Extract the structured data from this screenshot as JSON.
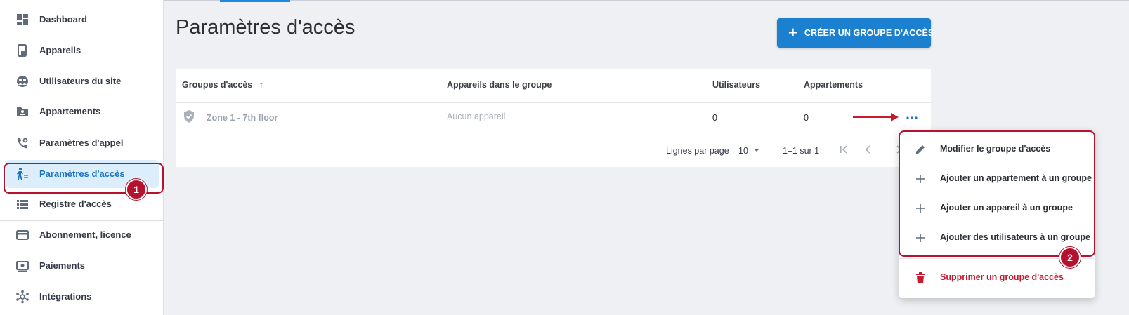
{
  "sidebar": {
    "items": [
      {
        "label": "Dashboard",
        "icon": "dashboard-icon"
      },
      {
        "label": "Appareils",
        "icon": "device-icon"
      },
      {
        "label": "Utilisateurs du site",
        "icon": "users-icon"
      },
      {
        "label": "Appartements",
        "icon": "apartment-icon"
      },
      {
        "label": "Paramètres d'appel",
        "icon": "call-settings-icon"
      },
      {
        "label": "Paramètres d'accès",
        "icon": "access-settings-icon",
        "active": true
      },
      {
        "label": "Registre d'accès",
        "icon": "access-log-icon"
      },
      {
        "label": "Abonnement, licence",
        "icon": "subscription-icon"
      },
      {
        "label": "Paiements",
        "icon": "payments-icon"
      },
      {
        "label": "Intégrations",
        "icon": "integrations-icon"
      }
    ]
  },
  "annotations": {
    "badge1": "1",
    "badge2": "2"
  },
  "header": {
    "title": "Paramètres d'accès",
    "create_button": "CRÉER UN GROUPE D'ACCÈS",
    "create_icon": "+"
  },
  "table": {
    "columns": [
      "Groupes d'accès",
      "Appareils dans le groupe",
      "Utilisateurs",
      "Appartements"
    ],
    "sort_icon": "↑",
    "rows": [
      {
        "group": "Zone 1 - 7th floor",
        "devices": "Aucun appareil",
        "users": "0",
        "apartments": "0"
      }
    ],
    "pagination": {
      "rows_per_page_label": "Lignes par page",
      "rows_per_page_value": "10",
      "range": "1–1 sur 1"
    }
  },
  "menu": {
    "items": [
      {
        "label": "Modifier le groupe d'accès",
        "icon": "edit-icon"
      },
      {
        "label": "Ajouter un appartement à un groupe",
        "icon": "plus-icon"
      },
      {
        "label": "Ajouter un appareil à un groupe",
        "icon": "plus-icon"
      },
      {
        "label": "Ajouter des utilisateurs à un groupe",
        "icon": "plus-icon"
      },
      {
        "label": "Supprimer un groupe d'accès",
        "icon": "trash-icon"
      }
    ]
  },
  "colors": {
    "accent": "#1a80cf",
    "active_bg": "#dceefc",
    "annotation": "#b5122f",
    "danger": "#c8192f"
  }
}
